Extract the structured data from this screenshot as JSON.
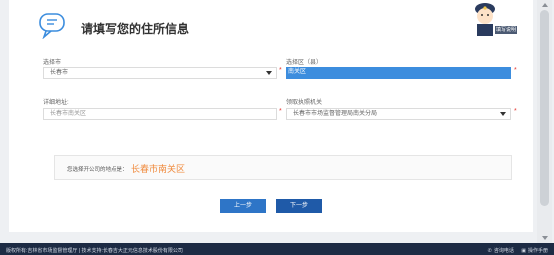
{
  "header": {
    "title": "请填写您的住所信息",
    "mascot_tag": "填写说明"
  },
  "form": {
    "city": {
      "label": "选择市",
      "value": "长春市"
    },
    "district": {
      "label": "选择区（县）",
      "value": "南关区"
    },
    "address": {
      "label": "详细地址:",
      "placeholder": "长春市南关区"
    },
    "authority": {
      "label": "领取执照机关",
      "value": "长春市市场监督管理局南关分局"
    }
  },
  "summary": {
    "label": "您选择开公司的地点是：",
    "value": "长春市南关区"
  },
  "buttons": {
    "prev": "上一步",
    "next": "下一步"
  },
  "footer": {
    "left": "版权所有:吉林省市场监督管理厅 | 技术支持:长春吉大正元信息技术股份有限公司",
    "hotline": "咨询电话",
    "manual": "操作手册"
  },
  "colors": {
    "primary": "#2e75c7",
    "accent": "#f08a3c",
    "required": "#e53935",
    "footer_bg": "#1d2b44"
  }
}
